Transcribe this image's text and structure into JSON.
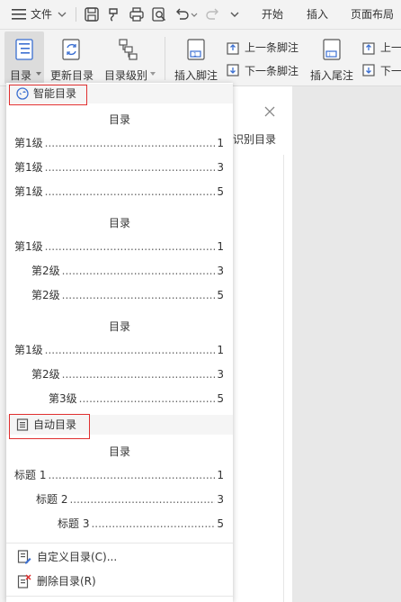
{
  "menubar": {
    "file_label": "文件",
    "tabs": [
      "开始",
      "插入",
      "页面布局"
    ]
  },
  "ribbon": {
    "toc_label": "目录",
    "update_toc_label": "更新目录",
    "toc_level_label": "目录级别",
    "insert_footnote_label": "插入脚注",
    "prev_footnote_label": "上一条脚注",
    "next_footnote_label": "下一条脚注",
    "insert_endnote_label": "插入尾注",
    "prev_clip_label": "上一",
    "next_clip_label": "下一"
  },
  "sidepanel": {
    "text": "识别目录"
  },
  "dropdown": {
    "smart_section_label": "智能目录",
    "auto_section_label": "自动目录",
    "dots": "..............................................................................................................",
    "previews": [
      {
        "title": "目录",
        "rows": [
          {
            "name": "第1级",
            "page": "1",
            "level": 1
          },
          {
            "name": "第1级",
            "page": "3",
            "level": 1
          },
          {
            "name": "第1级",
            "page": "5",
            "level": 1
          }
        ]
      },
      {
        "title": "目录",
        "rows": [
          {
            "name": "第1级",
            "page": "1",
            "level": 1
          },
          {
            "name": "第2级",
            "page": "3",
            "level": 2
          },
          {
            "name": "第2级",
            "page": "5",
            "level": 2
          }
        ]
      },
      {
        "title": "目录",
        "rows": [
          {
            "name": "第1级",
            "page": "1",
            "level": 1
          },
          {
            "name": "第2级",
            "page": "3",
            "level": 2
          },
          {
            "name": "第3级",
            "page": "5",
            "level": 3
          }
        ]
      },
      {
        "title": "目录",
        "rows": [
          {
            "name": "标题 1",
            "page": "1",
            "level": 1
          },
          {
            "name": "标题 2",
            "page": "3",
            "level": 2
          },
          {
            "name": "标题 3",
            "page": "5",
            "level": 3
          }
        ]
      }
    ],
    "custom_toc_label": "自定义目录(C)...",
    "delete_toc_label": "删除目录(R)"
  },
  "colors": {
    "accent": "#3b6fd1",
    "highlight_border": "#e03030",
    "delete_red": "#e03030"
  }
}
